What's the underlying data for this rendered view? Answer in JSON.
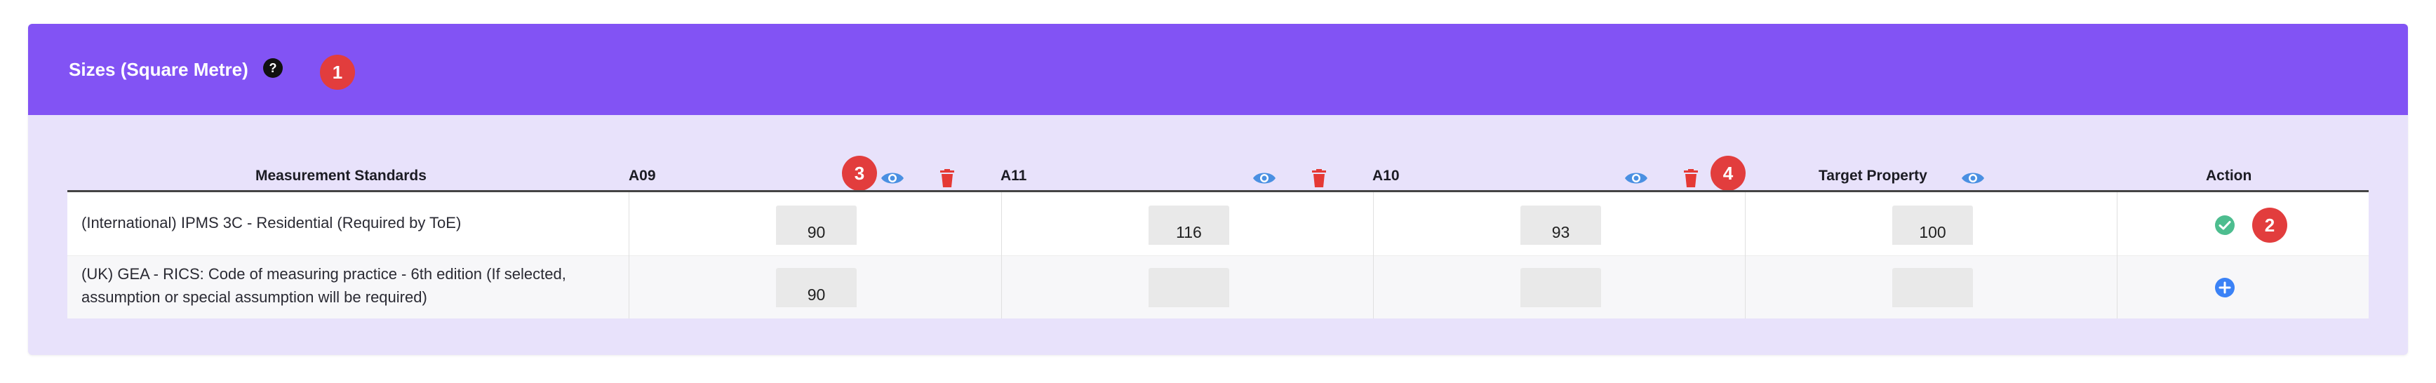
{
  "panel": {
    "title": "Sizes (Square Metre)",
    "help_icon": "question-circle-icon"
  },
  "columns": {
    "standards": "Measurement Standards",
    "a09": "A09",
    "a11": "A11",
    "a10": "A10",
    "target": "Target Property",
    "action": "Action"
  },
  "badges": [
    "1",
    "2",
    "3",
    "4"
  ],
  "rows": [
    {
      "standard": "(International) IPMS 3C - Residential (Required by ToE)",
      "values": [
        "90",
        "116",
        "93",
        "100"
      ],
      "action_icon": "check-circle-icon"
    },
    {
      "standard": "(UK) GEA - RICS: Code of measuring practice - 6th edition (If selected, assumption or special assumption will be required)",
      "values": [
        "90",
        "",
        "",
        ""
      ],
      "action_icon": "plus-circle-icon"
    }
  ],
  "colors": {
    "header": "#8253f4",
    "panel_bg": "#e8e2fb",
    "eye_icon": "#4a90e2",
    "trash_icon": "#e53935",
    "badge": "#e23d3d",
    "check": "#4dbd8f",
    "add": "#3b82f6"
  }
}
